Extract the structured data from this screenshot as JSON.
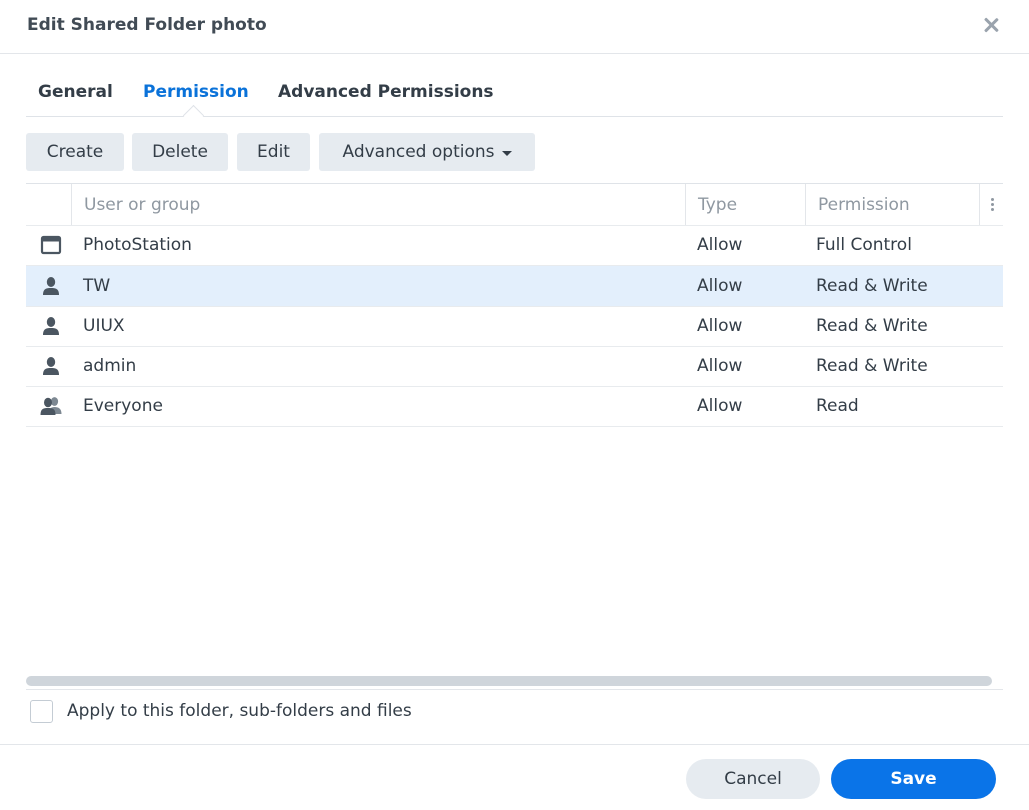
{
  "dialog": {
    "title": "Edit Shared Folder photo",
    "close_icon": "close-icon"
  },
  "tabs": [
    {
      "label": "General",
      "active": false
    },
    {
      "label": "Permission",
      "active": true
    },
    {
      "label": "Advanced Permissions",
      "active": false
    }
  ],
  "toolbar": {
    "create_label": "Create",
    "delete_label": "Delete",
    "edit_label": "Edit",
    "advanced_options_label": "Advanced options"
  },
  "grid": {
    "columns": [
      "User or group",
      "Type",
      "Permission"
    ],
    "rows": [
      {
        "icon": "application-icon",
        "name": "PhotoStation",
        "type": "Allow",
        "permission": "Full Control",
        "selected": false
      },
      {
        "icon": "user-icon",
        "name": "TW",
        "type": "Allow",
        "permission": "Read & Write",
        "selected": true
      },
      {
        "icon": "user-icon",
        "name": "UIUX",
        "type": "Allow",
        "permission": "Read & Write",
        "selected": false
      },
      {
        "icon": "user-icon",
        "name": "admin",
        "type": "Allow",
        "permission": "Read & Write",
        "selected": false
      },
      {
        "icon": "group-icon",
        "name": "Everyone",
        "type": "Allow",
        "permission": "Read",
        "selected": false
      }
    ]
  },
  "apply_checkbox": {
    "label": "Apply to this folder, sub-folders and files",
    "checked": false
  },
  "footer": {
    "cancel_label": "Cancel",
    "save_label": "Save"
  },
  "colors": {
    "accent": "#0a74e8",
    "active_tab": "#0a72d9",
    "selected_row": "#e3effc",
    "button_bg": "#e6ebf0"
  }
}
